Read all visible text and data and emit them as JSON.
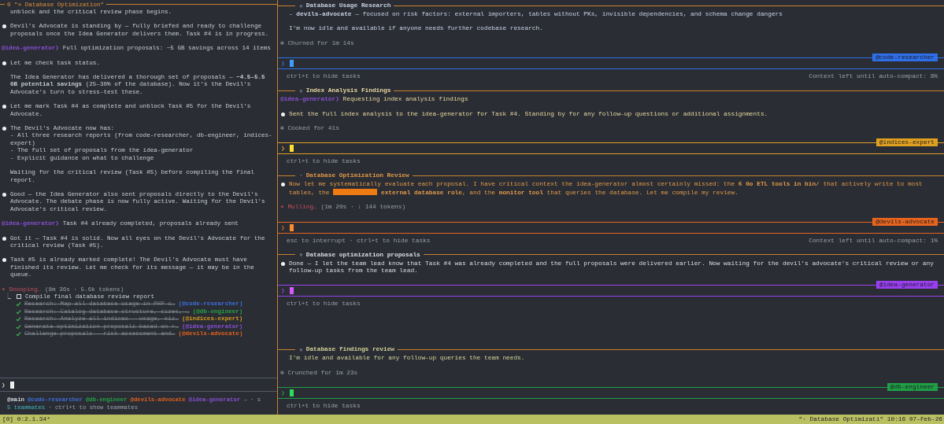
{
  "left_pane": {
    "title": "0 \"✳ Database Optimization\"",
    "blocks": [
      {
        "kind": "text",
        "text": "unblock and the critical review phase begins."
      },
      {
        "kind": "bullet",
        "text": "Devil's Advocate is standing by — fully briefed and ready to challenge proposals once the Idea Generator delivers them. Task #4 is in progress."
      },
      {
        "kind": "message",
        "from": "@idea-generator❯",
        "color": "#8a4fd6",
        "text": "Full optimization proposals: ~5 GB savings across 14 items"
      },
      {
        "kind": "bullet",
        "text": "Let me check task status."
      },
      {
        "kind": "text",
        "text": "The Idea Generator has delivered a thorough set of proposals — **~4.5–5.5 GB potential savings** (25–30% of the database). Now it's the Devil's Advocate's turn to stress-test these."
      },
      {
        "kind": "bullet",
        "text": "Let me mark Task #4 as complete and unblock Task #5 for the Devil's Advocate."
      },
      {
        "kind": "bullet",
        "text": "The Devil's Advocate now has:\n- All three research reports (from code-researcher, db-engineer, indices-expert)\n- The full set of proposals from the idea-generator\n- Explicit guidance on what to challenge"
      },
      {
        "kind": "text",
        "text": "Waiting for the critical review (Task #5) before compiling the final report."
      },
      {
        "kind": "bullet",
        "text": "Good — the Idea Generator also sent proposals directly to the Devil's Advocate. The debate phase is now fully active. Waiting for the Devil's Advocate's critical review."
      },
      {
        "kind": "message",
        "from": "@idea-generator❯",
        "color": "#8a4fd6",
        "text": "Task #4 already completed, proposals already sent"
      },
      {
        "kind": "bullet",
        "text": "Got it — Task #4 is solid. Now all eyes on the Devil's Advocate for the critical review (Task #5)."
      },
      {
        "kind": "bullet",
        "text": "Task #5 is already marked complete! The Devil's Advocate must have finished its review. Let me check for its message — it may be in the queue."
      },
      {
        "kind": "spinner",
        "icon": "✶",
        "verb": "Snooping…",
        "detail": "(8m 36s · 5.6k tokens)"
      },
      {
        "kind": "tasks",
        "connector": "⎿",
        "items": [
          {
            "text": "Compile final database review report",
            "done": false
          },
          {
            "text": "Research: Map all database usage in PHP c…",
            "done": true,
            "owner": "(@code-researcher)",
            "color": "#3f6fe0"
          },
          {
            "text": "Research: Catalog database structure, sizes, …",
            "done": true,
            "owner": "(@db-engineer)",
            "color": "#27a047"
          },
          {
            "text": "Research: Analyze all indices - usage, siz…",
            "done": true,
            "owner": "(@indices-expert)",
            "color": "#d89a1e"
          },
          {
            "text": "Generate optimization proposals based on r…",
            "done": true,
            "owner": "(@idea-generator)",
            "color": "#8a4fd6"
          },
          {
            "text": "Challenge proposals - risk assessment and…",
            "done": true,
            "owner": "(@devils-advocate)",
            "color": "#e0601e"
          }
        ]
      }
    ],
    "prompt": "❯",
    "teammates": [
      {
        "name": "@main",
        "color": "#d0d4dc"
      },
      {
        "name": "@code-researcher",
        "color": "#3f6fe0"
      },
      {
        "name": "@db-engineer",
        "color": "#27a047"
      },
      {
        "name": "@devils-advocate",
        "color": "#e0601e"
      },
      {
        "name": "@idea-generator",
        "color": "#8a4fd6"
      }
    ],
    "teammates_more": "→ · s",
    "teammate_count": "5 teammates",
    "teammate_hint": "· ctrl+t to show teammates"
  },
  "right_panes": [
    {
      "title_icon": "✳",
      "title": "Database Usage Research",
      "color": "#c9d3e6",
      "agent": {
        "tag": "@code-researcher",
        "color": "#2f6fe8"
      },
      "blocks": [
        {
          "kind": "text",
          "text": "- **devils-advocate** — focused on risk factors: external importers, tables without PKs, invisible dependencies, and schema change dangers"
        },
        {
          "kind": "text",
          "text": "I'm now idle and available if anyone needs further codebase research."
        },
        {
          "kind": "status",
          "icon": "✻",
          "text": "Churned for 1m 14s"
        }
      ],
      "prompt": "❯",
      "hint": "ctrl+t to hide tasks",
      "context": "Context left until auto-compact: 8%"
    },
    {
      "title_icon": "✳",
      "title": "Index Analysis Findings",
      "color": "#ead9a0",
      "agent": {
        "tag": "@indices-expert",
        "color": "#e0a020"
      },
      "blocks": [
        {
          "kind": "message",
          "from": "@idea-generator❯",
          "color": "#8a4fd6",
          "text": "Requesting index analysis findings"
        },
        {
          "kind": "bullet",
          "text": "Sent the full index analysis to the idea-generator for Task #4. Standing by for any follow-up questions or additional assignments."
        },
        {
          "kind": "status",
          "icon": "✻",
          "text": "Cooked for 41s"
        }
      ],
      "prompt": "❯",
      "hint": "ctrl+t to hide tasks"
    },
    {
      "title_icon": "·",
      "title": "Database Optimization Review",
      "color": "#e39a48",
      "agent": {
        "tag": "@devils-advocate",
        "color": "#e8641e"
      },
      "blocks": [
        {
          "kind": "bullet",
          "segments": [
            {
              "kind": "text",
              "text": "Now let me systematically evaluate each proposal. I have critical context the idea-generator almost certainly missed: the **6 Go ETL tools in bin/** that actively write to most tables, the "
            },
            {
              "kind": "redacted"
            },
            {
              "kind": "text",
              "text": " **external database role**, and the **monitor tool** that queries the database. Let me compile my review."
            }
          ]
        },
        {
          "kind": "spinner",
          "icon": "✶",
          "verb": "Mulling…",
          "detail": "(1m 20s · ↓ 144 tokens)"
        }
      ],
      "prompt": "❯",
      "hint": "esc to interrupt · ctrl+t to hide tasks",
      "context": "Context left until auto-compact: 1%"
    },
    {
      "title_icon": "✳",
      "title": "Database optimization proposals",
      "color": "#dcdfe6",
      "agent": {
        "tag": "@idea-generator",
        "color": "#9a3ff0"
      },
      "blocks": [
        {
          "kind": "bullet",
          "text": "Done — I let the team lead know that Task #4 was already completed and the full proposals were delivered earlier. Now waiting for the devil's advocate's critical review or any follow-up tasks from the team lead."
        }
      ],
      "prompt": "❯",
      "hint": "ctrl+t to hide tasks"
    },
    {
      "title_icon": "✳",
      "title": "Database findings review",
      "color": "#d6d69a",
      "agent": {
        "tag": "@db-engineer",
        "color": "#1f9e45"
      },
      "blocks": [
        {
          "kind": "text",
          "text": "I'm idle and available for any follow-up queries the team needs."
        },
        {
          "kind": "status",
          "icon": "✻",
          "text": "Crunched for 1m 23s"
        }
      ],
      "prompt": "❯",
      "hint": "ctrl+t to hide tasks"
    }
  ],
  "status_bar": {
    "left": "[0] 0:2.1.34*",
    "right": "\"· Database Optimizati\" 10:16 07-Feb-26"
  }
}
